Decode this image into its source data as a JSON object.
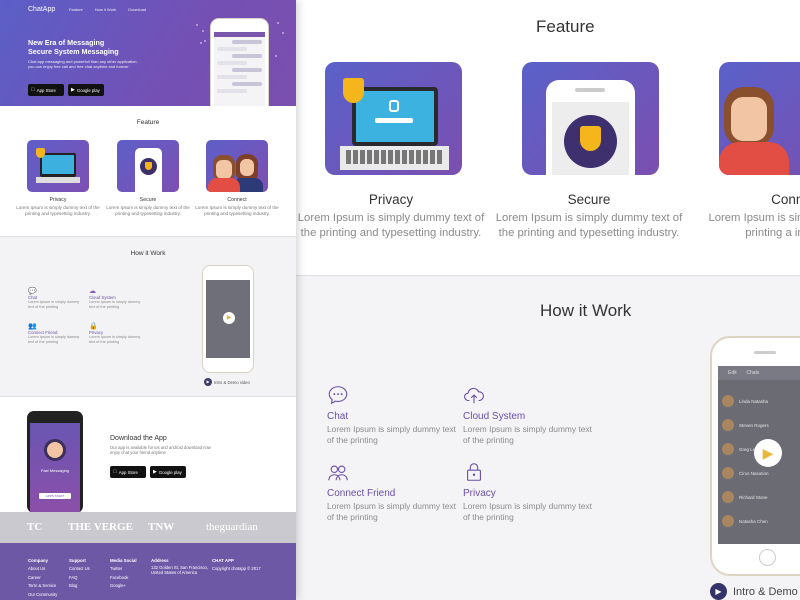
{
  "hero": {
    "logo": "ChatApp",
    "nav": [
      "Feature",
      "How it Work",
      "Download"
    ],
    "headline_line1": "New Era of Messaging",
    "headline_line2": "Secure System Messaging",
    "description": "Chat app messaging and powerfull than any other application, you can enjoy free call and free chat anytime and forever",
    "app_store": "App Store",
    "google_play": "Google play"
  },
  "feature": {
    "title": "Feature",
    "cards": [
      {
        "title": "Privacy",
        "desc": "Lorem Ipsum is simply dummy text of the printing and typesetting industry."
      },
      {
        "title": "Secure",
        "desc": "Lorem Ipsum is simply dummy text of the printing and typesetting industry."
      },
      {
        "title": "Connect",
        "desc": "Lorem Ipsum is simply dummy text of the printing and typesetting industry."
      }
    ],
    "right_cards": [
      {
        "title": "Privacy",
        "desc": "Lorem Ipsum is simply dummy text of the printing and typesetting industry."
      },
      {
        "title": "Secure",
        "desc": "Lorem Ipsum is simply dummy text of the printing and typesetting industry."
      },
      {
        "title": "Conne",
        "desc": "Lorem Ipsum is simply text of the printing a industry."
      }
    ]
  },
  "how": {
    "title": "How it Work",
    "items": [
      {
        "title": "Chat",
        "desc": "Lorem Ipsum is simply dummy text of the printing",
        "icon": "chat-icon"
      },
      {
        "title": "Cloud System",
        "desc": "Lorem Ipsum is simply dummy text of the printing",
        "icon": "cloud-icon"
      },
      {
        "title": "Connect Friend",
        "desc": "Lorem Ipsum is simply dummy text of the printing",
        "icon": "friends-icon"
      },
      {
        "title": "Privacy",
        "desc": "Lorem Ipsum is simply dummy text of the printing",
        "icon": "lock-icon"
      }
    ],
    "demo": "Intro & Demo video",
    "demo_right": "Intro & Demo v",
    "phone_title": "Chats",
    "phone_edit": "Edit",
    "contacts": [
      "Linda Natasha",
      "Steven Rogers",
      "Greg Leonard",
      "Cirus Nasution",
      "Richard Stone",
      "Natasha Chen"
    ]
  },
  "download": {
    "title": "Download the App",
    "desc": "Our app is available for ios and android download now enjoy chat your friend anytime",
    "phone_label": "Fast Messaging",
    "phone_button": "APPS START"
  },
  "press": [
    "TC",
    "THE VERGE",
    "TNW",
    "theguardian"
  ],
  "footer": {
    "company": {
      "h": "Company",
      "items": [
        "About Us",
        "Career",
        "Term & Service",
        "Our Community"
      ]
    },
    "support": {
      "h": "Support",
      "items": [
        "Contact Us",
        "FAQ",
        "Blog"
      ]
    },
    "social": {
      "h": "Media Social",
      "items": [
        "Twitter",
        "Facebook",
        "Google+"
      ]
    },
    "address": {
      "h": "Address",
      "line1": "132 Golden St, San Francisco,",
      "line2": "United States of America"
    },
    "brand": {
      "h": "CHAT APP",
      "copy": "Copyright chatapp © 2017"
    }
  },
  "colors": {
    "accent": "#6d58a6",
    "gradient_start": "#5b5fc7",
    "gradient_end": "#7e4fb2",
    "play": "#e9b73c"
  }
}
